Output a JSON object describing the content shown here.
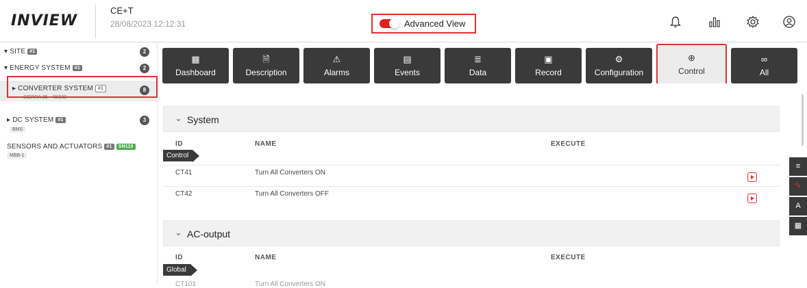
{
  "app": {
    "logo": "INVIEW",
    "site_name": "CE+T",
    "datetime": "28/08/2023 12:12:31"
  },
  "header": {
    "advanced_view_label": "Advanced View",
    "advanced_view_on": true,
    "icons": [
      "bell-icon",
      "bar-chart-icon",
      "gear-icon",
      "user-icon"
    ]
  },
  "sidebar": {
    "items": [
      {
        "label": "SITE",
        "badge": "#1",
        "count": "2"
      },
      {
        "label": "ENERGY SYSTEM",
        "badge": "#1",
        "count": "2"
      },
      {
        "label": "CONVERTER SYSTEM",
        "badge": "#1",
        "count": "8",
        "sub": "SIERRA 25 - 48/230"
      },
      {
        "label": "DC SYSTEM",
        "badge": "#1",
        "count": "3",
        "sub": "BMS"
      },
      {
        "label": "SENSORS AND ACTUATORS",
        "badge": "#1",
        "badge2": "SN110",
        "sub": "MBB-1"
      }
    ]
  },
  "toolbar": {
    "tabs": [
      {
        "label": "Dashboard",
        "icon": "▦"
      },
      {
        "label": "Description",
        "icon": "🗎"
      },
      {
        "label": "Alarms",
        "icon": "⚠"
      },
      {
        "label": "Events",
        "icon": "▤"
      },
      {
        "label": "Data",
        "icon": "≣"
      },
      {
        "label": "Record",
        "icon": "▣"
      },
      {
        "label": "Configuration",
        "icon": "⚙"
      },
      {
        "label": "Control",
        "icon": "⊕"
      },
      {
        "label": "All",
        "icon": "∞"
      }
    ],
    "active_tab": "Control"
  },
  "sections": [
    {
      "title": "System",
      "tag": "Control",
      "columns": {
        "id": "ID",
        "name": "NAME",
        "execute": "EXECUTE"
      },
      "rows": [
        {
          "id": "CT41",
          "name": "Turn All Converters ON"
        },
        {
          "id": "CT42",
          "name": "Turn All Converters OFF"
        }
      ]
    },
    {
      "title": "AC-output",
      "tag": "Global",
      "columns": {
        "id": "ID",
        "name": "NAME",
        "execute": "EXECUTE"
      },
      "rows": [
        {
          "id": "CT101",
          "name": "Turn All Converters ON"
        }
      ]
    }
  ],
  "side_buttons": [
    "filter-icon",
    "pen-icon",
    "spellcheck-icon",
    "dashboard-icon"
  ],
  "colors": {
    "accent": "#e03030",
    "dark": "#3a3a3a"
  }
}
